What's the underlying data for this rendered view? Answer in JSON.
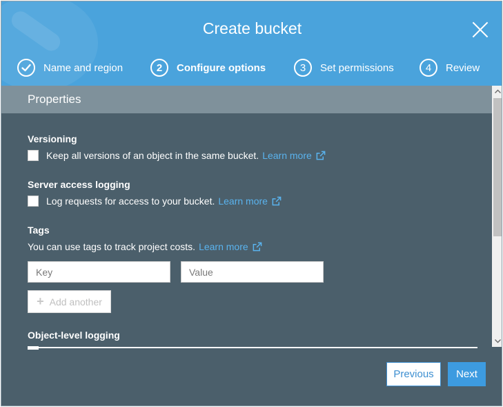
{
  "dialog": {
    "title": "Create bucket"
  },
  "steps": [
    {
      "number": "",
      "label": "Name and region",
      "state": "done"
    },
    {
      "number": "2",
      "label": "Configure options",
      "state": "active"
    },
    {
      "number": "3",
      "label": "Set permissions",
      "state": "pending"
    },
    {
      "number": "4",
      "label": "Review",
      "state": "pending"
    }
  ],
  "properties": {
    "header": "Properties",
    "versioning": {
      "title": "Versioning",
      "checkbox_label": "Keep all versions of an object in the same bucket.",
      "checked": false,
      "link": "Learn more"
    },
    "logging": {
      "title": "Server access logging",
      "checkbox_label": "Log requests for access to your bucket.",
      "checked": false,
      "link": "Learn more"
    },
    "tags": {
      "title": "Tags",
      "description": "You can use tags to track project costs.",
      "link": "Learn more",
      "key_placeholder": "Key",
      "value_placeholder": "Value",
      "add_label": "Add another"
    },
    "object_logging": {
      "title": "Object-level logging"
    }
  },
  "footer": {
    "previous_label": "Previous",
    "next_label": "Next"
  },
  "colors": {
    "header_bg": "#4aa3dc",
    "body_bg": "#4b5f6b",
    "link": "#5ab3ee",
    "primary_button": "#3d9be0"
  }
}
